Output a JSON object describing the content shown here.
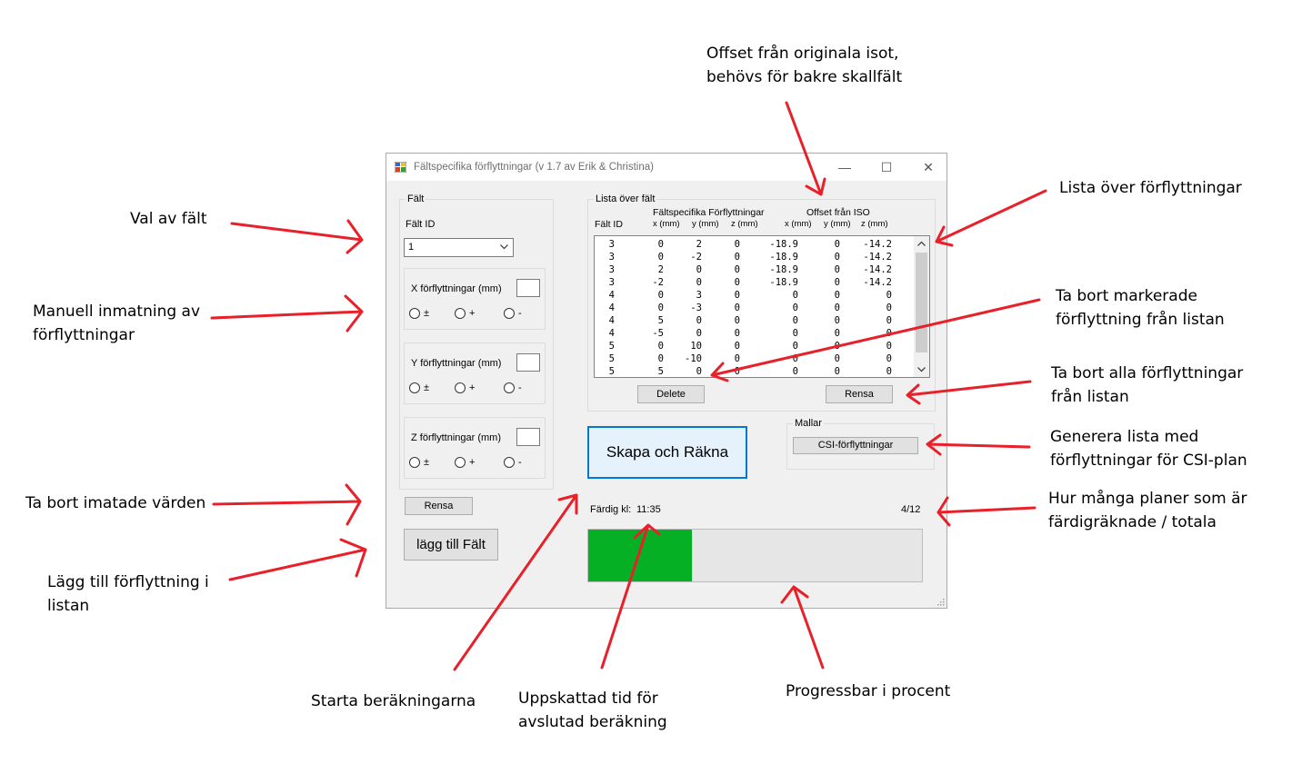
{
  "window": {
    "title": "Fältspecifika förflyttningar (v 1.7 av Erik & Christina)",
    "minimize": "—",
    "maximize": "☐",
    "close": "✕"
  },
  "falt_group": {
    "label": "Fält",
    "id_label": "Fält ID",
    "id_selected": "1",
    "x": {
      "label": "X förflyttningar (mm)",
      "opt1": "±",
      "opt2": "+",
      "opt3": "-"
    },
    "y": {
      "label": "Y förflyttningar (mm)",
      "opt1": "±",
      "opt2": "+",
      "opt3": "-"
    },
    "z": {
      "label": "Z förflyttningar (mm)",
      "opt1": "±",
      "opt2": "+",
      "opt3": "-"
    },
    "clear_button": "Rensa",
    "add_button": "lägg till Fält"
  },
  "list_group": {
    "label": "Lista över fält",
    "header_fs": "Fältspecifika Förflyttningar",
    "header_iso": "Offset från ISO",
    "col_id": "Fält ID",
    "col_x": "x (mm)",
    "col_y": "y (mm)",
    "col_z": "z (mm)",
    "col_ox": "x (mm)",
    "col_oy": "y (mm)",
    "col_oz": "z (mm)",
    "rows": [
      [
        "3",
        "0",
        "2",
        "0",
        "-18.9",
        "0",
        "-14.2"
      ],
      [
        "3",
        "0",
        "-2",
        "0",
        "-18.9",
        "0",
        "-14.2"
      ],
      [
        "3",
        "2",
        "0",
        "0",
        "-18.9",
        "0",
        "-14.2"
      ],
      [
        "3",
        "-2",
        "0",
        "0",
        "-18.9",
        "0",
        "-14.2"
      ],
      [
        "4",
        "0",
        "3",
        "0",
        "0",
        "0",
        "0"
      ],
      [
        "4",
        "0",
        "-3",
        "0",
        "0",
        "0",
        "0"
      ],
      [
        "4",
        "5",
        "0",
        "0",
        "0",
        "0",
        "0"
      ],
      [
        "4",
        "-5",
        "0",
        "0",
        "0",
        "0",
        "0"
      ],
      [
        "5",
        "0",
        "10",
        "0",
        "0",
        "0",
        "0"
      ],
      [
        "5",
        "0",
        "-10",
        "0",
        "0",
        "0",
        "0"
      ],
      [
        "5",
        "5",
        "0",
        "0",
        "0",
        "0",
        "0"
      ]
    ],
    "delete_button": "Delete",
    "clear_button": "Rensa"
  },
  "main": {
    "run_button": "Skapa och Räkna",
    "templates_label": "Mallar",
    "csi_button": "CSI-förflyttningar",
    "done_label": "Färdig kl:",
    "done_time": "11:35",
    "count": "4/12",
    "progress": 0.31,
    "progress_color": "#06b025"
  },
  "annotations": {
    "offset": [
      "Offset från originala isot,",
      "behövs för bakre skallfält"
    ],
    "list": [
      "Lista över förflyttningar"
    ],
    "remove_selected": [
      "Ta bort markerade",
      "förflyttning från listan"
    ],
    "remove_all": [
      "Ta bort alla förflyttningar",
      "från listan"
    ],
    "generate_csi": [
      "Generera lista med",
      "förflyttningar för CSI-plan"
    ],
    "count": [
      "Hur många planer som är",
      "färdigräknade / totala"
    ],
    "choose_field": [
      "Val av fält"
    ],
    "manual_input": [
      "Manuell inmatning av",
      "förflyttningar"
    ],
    "remove_input": [
      "Ta bort imatade värden"
    ],
    "add_to_list": [
      "Lägg till förflyttning i",
      "listan"
    ],
    "start": [
      "Starta beräkningarna"
    ],
    "est_time": [
      "Uppskattad tid för",
      "avslutad beräkning"
    ],
    "progress": [
      "Progressbar i procent"
    ]
  },
  "arrow_color": "#e8202a"
}
